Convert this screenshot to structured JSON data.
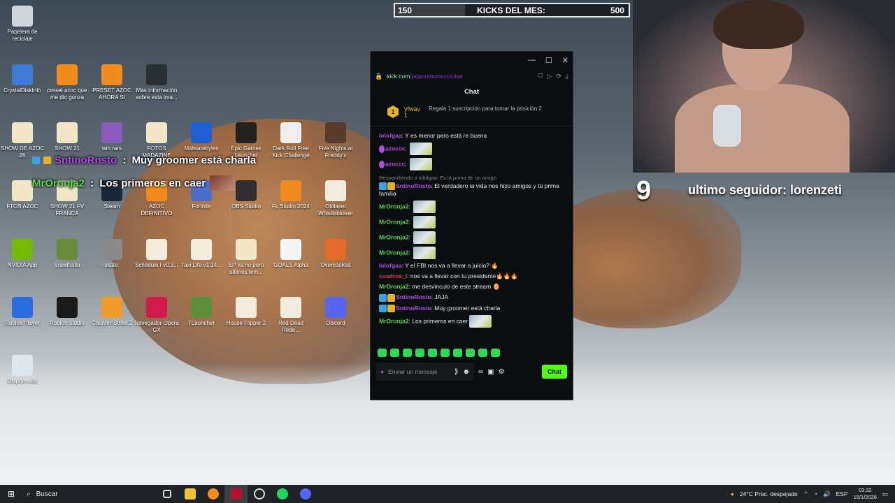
{
  "colors": {
    "kick_green": "#53fc18",
    "username_purple": "#b04be0",
    "username_green": "#5bd34e",
    "username_red": "#e0314b",
    "username_teal": "#7ed6c8"
  },
  "desktop": {
    "icons": [
      {
        "label": "Papelera de reciclaje",
        "icon": "recycle-bin-icon"
      },
      {
        "label": "CrystalDiskInfo",
        "icon": "crystaldiskinfo-icon"
      },
      {
        "label": "preset azoc que me dio gonza",
        "icon": "fl-studio-icon"
      },
      {
        "label": "PRESET AZOC AHORA SI",
        "icon": "fl-studio-icon"
      },
      {
        "label": "Más información sobre esta ima...",
        "icon": "info-camera-icon"
      },
      {
        "label": "SHOW DE AZOC 26",
        "icon": "folder-icon"
      },
      {
        "label": "SHOW 21",
        "icon": "folder-icon"
      },
      {
        "label": "win rars",
        "icon": "winrar-icon"
      },
      {
        "label": "FOTOS MADAZINE",
        "icon": "folder-icon"
      },
      {
        "label": "Malwarebytes",
        "icon": "malwarebytes-icon"
      },
      {
        "label": "Epic Games Launcher",
        "icon": "epic-games-icon"
      },
      {
        "label": "Dark Roll Free Kick Challenge",
        "icon": "soccer-ball-icon"
      },
      {
        "label": "Five Nights at Freddy's",
        "icon": "fnaf-icon"
      },
      {
        "label": "FTOS AZOC",
        "icon": "folder-icon"
      },
      {
        "label": "SHOW 21 FV FRANCA",
        "icon": "folder-icon"
      },
      {
        "label": "Steam",
        "icon": "steam-icon"
      },
      {
        "label": "AZOC DEFINITIVO",
        "icon": "fl-studio-icon"
      },
      {
        "label": "Fortnite",
        "icon": "fortnite-icon"
      },
      {
        "label": "OBS Studio",
        "icon": "obs-icon"
      },
      {
        "label": "FL Studio 2024",
        "icon": "fl-studio-icon"
      },
      {
        "label": "Oldlaser Whistleblower",
        "icon": "file-icon"
      },
      {
        "label": "NVIDIA App",
        "icon": "nvidia-icon"
      },
      {
        "label": "Brawlhalla",
        "icon": "brawlhalla-icon"
      },
      {
        "label": "skate.",
        "icon": "skate-icon"
      },
      {
        "label": "Schedule I v0.3...",
        "icon": "file-icon"
      },
      {
        "label": "Taxi Life v1.14...",
        "icon": "file-icon"
      },
      {
        "label": "EP va no pero ultimos tem...",
        "icon": "folder-icon"
      },
      {
        "label": "GOALS Alpha",
        "icon": "goals-icon"
      },
      {
        "label": "Overcooked",
        "icon": "overcooked-icon"
      },
      {
        "label": "Roblox Player",
        "icon": "roblox-icon"
      },
      {
        "label": "Roblox Studio",
        "icon": "roblox-studio-icon"
      },
      {
        "label": "Counter-Strike 2",
        "icon": "cs2-icon"
      },
      {
        "label": "Navegador Opera GX",
        "icon": "opera-gx-icon"
      },
      {
        "label": "TLauncher",
        "icon": "minecraft-icon"
      },
      {
        "label": "House Flipper 2",
        "icon": "file-icon"
      },
      {
        "label": "Red Dead Rede...",
        "icon": "file-icon"
      },
      {
        "label": "Discord",
        "icon": "discord-icon"
      },
      {
        "label": "Dolphin-x64",
        "icon": "dolphin-icon"
      }
    ]
  },
  "kicks_bar": {
    "current": "150",
    "label": "KICKS DEL MES:",
    "goal": "500",
    "progress": 0.3
  },
  "stream_overlay": {
    "counter": "9",
    "last_follower": "ultimo seguidor: lorenzeti",
    "chat_messages": [
      {
        "user": "SntinoRnsto",
        "sep": " : ",
        "text": "Muy groomer está charla"
      },
      {
        "user": "MrOronja2",
        "sep": " : ",
        "text": "Los primeros en caer"
      }
    ]
  },
  "chat_window": {
    "url_domain": "kick.com",
    "url_path": "/popout/azoccc/chat",
    "title": "Chat",
    "pinned": {
      "rank": "1",
      "user": "yfwav",
      "subs": "1",
      "info": "Regala 1 suscripción para tomar la posición 2"
    },
    "messages": [
      {
        "user": "lolofgaa",
        "user_color": "#b04be0",
        "text": "Y es menor pero está re buena"
      },
      {
        "user": "azoccc",
        "user_color": "#b04be0",
        "text": "",
        "emote": true,
        "mic": true
      },
      {
        "user": "azoccc",
        "user_color": "#b04be0",
        "text": "",
        "emote": true,
        "mic": true
      },
      {
        "reply": "Respondiendo a lolofgaa: Es la prima de un amigo"
      },
      {
        "user": "SntinoRnsto",
        "user_color": "#b04be0",
        "text": "El verdadero la vida nos hizo amigos y tú prima familia",
        "badges": true
      },
      {
        "user": "MrOronja2",
        "user_color": "#5bd34e",
        "text": "",
        "emote": true
      },
      {
        "user": "MrOronja2",
        "user_color": "#5bd34e",
        "text": "",
        "emote": true
      },
      {
        "user": "MrOronja2",
        "user_color": "#5bd34e",
        "text": "",
        "emote": true
      },
      {
        "user": "MrOronja2",
        "user_color": "#5bd34e",
        "text": "",
        "emote": true
      },
      {
        "user": "lolofgaa",
        "user_color": "#b04be0",
        "text": "Y el FBI nos va a llevar a juicio? 🔥"
      },
      {
        "user": "cuadros_l",
        "user_color": "#e0314b",
        "text": "nos va a llevar con tu presidente🔥🔥🔥"
      },
      {
        "user": "MrOronja2",
        "user_color": "#5bd34e",
        "text": "me desvinculo de este stream 🥚"
      },
      {
        "user": "SntinoRnsto",
        "user_color": "#b04be0",
        "text": "JAJA",
        "badges": true
      },
      {
        "user": "SntinoRnsto",
        "user_color": "#b04be0",
        "text": "Muy groomer está charla",
        "badges": true
      },
      {
        "user": "MrOronja2",
        "user_color": "#5bd34e",
        "text": "Los primeros en caer",
        "emote": true
      }
    ],
    "input_placeholder": "Enviar un mensaje",
    "send_label": "Chat"
  },
  "taskbar": {
    "search_label": "Buscar",
    "weather": "24°C  Prac. despejado",
    "language": "ESP",
    "time": "03:32",
    "date": "15/1/2026"
  }
}
